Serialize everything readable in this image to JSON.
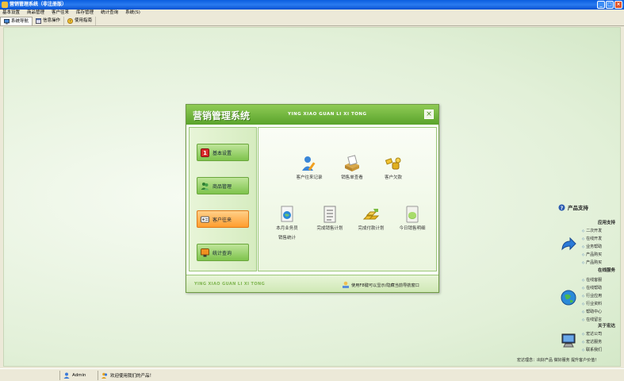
{
  "window": {
    "title": "营销管理系统（非注册版）"
  },
  "menu": [
    "基本设置",
    "商品管理",
    "客户往来",
    "库存管理",
    "统计查询",
    "系统(S)"
  ],
  "toolbar": [
    {
      "label": "系统导航",
      "icon": "monitor-icon"
    },
    {
      "label": "信息操作",
      "icon": "window-icon"
    },
    {
      "label": "使用指南",
      "icon": "help-icon"
    }
  ],
  "dialog": {
    "title": "营销管理系统",
    "pinyin": "YING XIAO GUAN LI XI TONG",
    "footer_pinyin": "YING XIAO GUAN LI XI TONG",
    "footer_hint": "使用F8键可以显示/隐藏当前导航窗口",
    "nav": [
      "基本设置",
      "商品管理",
      "客户往来",
      "统计查询"
    ],
    "items": [
      {
        "label": "客户往来记录",
        "icon": "person-pen-icon"
      },
      {
        "label": "销售单查看",
        "icon": "document-box-icon"
      },
      {
        "label": "客户欠款",
        "icon": "money-bag-icon"
      },
      {
        "label": "本月业务员",
        "label2": "销售统计",
        "icon": "globe-document-icon"
      },
      {
        "label": "完成销售计划",
        "icon": "checklist-icon"
      },
      {
        "label": "完成付款计划",
        "icon": "gold-bars-icon"
      },
      {
        "label": "今日销售明细",
        "icon": "coin-page-icon"
      }
    ]
  },
  "support": {
    "title": "产品支持",
    "sections": [
      {
        "heading": "应用支持",
        "items": [
          "二次开发",
          "在线开发",
          "业务帮助",
          "产品购买",
          "产品购买"
        ]
      },
      {
        "heading": "在线服务",
        "items": [
          "在线客服",
          "在线帮助",
          "行业应用",
          "行业资料",
          "帮助中心",
          "在线留言"
        ]
      },
      {
        "heading": "关于宏达",
        "items": [
          "宏达公司",
          "宏达服务",
          "联系我们"
        ]
      }
    ],
    "slogan": "宏达理念：出好产品 做好服务 提升客户价值！"
  },
  "status": {
    "user": "Admin",
    "welcome": "欢迎使用我们的产品！"
  }
}
